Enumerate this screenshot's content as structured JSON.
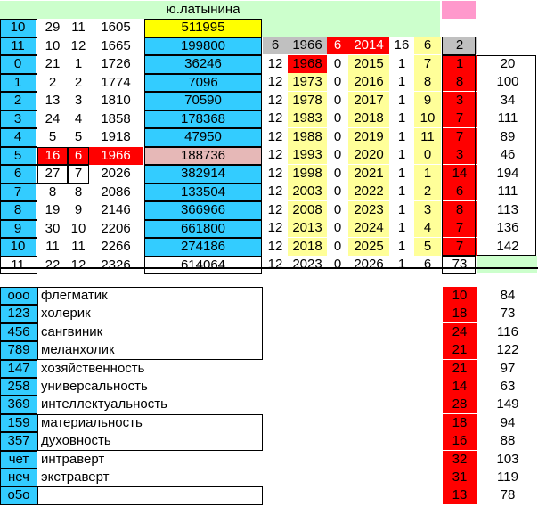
{
  "header": {
    "name": "ю.латынина"
  },
  "rows": [
    {
      "n": "10",
      "a": "29",
      "b": "11",
      "y": "1605",
      "v": "511995"
    },
    {
      "n": "11",
      "a": "10",
      "b": "12",
      "y": "1665",
      "v": "199800"
    },
    {
      "n": "0",
      "a": "21",
      "b": "1",
      "y": "1726",
      "v": "36246"
    },
    {
      "n": "1",
      "a": "2",
      "b": "2",
      "y": "1774",
      "v": "7096"
    },
    {
      "n": "2",
      "a": "13",
      "b": "3",
      "y": "1810",
      "v": "70590"
    },
    {
      "n": "3",
      "a": "24",
      "b": "4",
      "y": "1858",
      "v": "178368"
    },
    {
      "n": "4",
      "a": "5",
      "b": "5",
      "y": "1918",
      "v": "47950"
    },
    {
      "n": "5",
      "a": "16",
      "b": "6",
      "y": "1966",
      "v": "188736"
    },
    {
      "n": "6",
      "a": "27",
      "b": "7",
      "y": "2026",
      "v": "382914"
    },
    {
      "n": "7",
      "a": "8",
      "b": "8",
      "y": "2086",
      "v": "133504"
    },
    {
      "n": "8",
      "a": "19",
      "b": "9",
      "y": "2146",
      "v": "366966"
    },
    {
      "n": "9",
      "a": "30",
      "b": "10",
      "y": "2206",
      "v": "661800"
    },
    {
      "n": "10",
      "a": "11",
      "b": "11",
      "y": "2266",
      "v": "274186"
    },
    {
      "n": "11",
      "a": "22",
      "b": "12",
      "y": "2326",
      "v": "614064"
    }
  ],
  "cycle": [
    {
      "a": "6",
      "b": "1966",
      "c": "6",
      "d": "2014",
      "e": "16",
      "f": "6",
      "g": "2",
      "h": ""
    },
    {
      "a": "12",
      "b": "1968",
      "c": "0",
      "d": "2015",
      "e": "1",
      "f": "7",
      "g": "1",
      "h": "20"
    },
    {
      "a": "12",
      "b": "1973",
      "c": "0",
      "d": "2016",
      "e": "1",
      "f": "8",
      "g": "8",
      "h": "100"
    },
    {
      "a": "12",
      "b": "1978",
      "c": "0",
      "d": "2017",
      "e": "1",
      "f": "9",
      "g": "3",
      "h": "34"
    },
    {
      "a": "12",
      "b": "1983",
      "c": "0",
      "d": "2018",
      "e": "1",
      "f": "10",
      "g": "7",
      "h": "111"
    },
    {
      "a": "12",
      "b": "1988",
      "c": "0",
      "d": "2019",
      "e": "1",
      "f": "11",
      "g": "7",
      "h": "89"
    },
    {
      "a": "12",
      "b": "1993",
      "c": "0",
      "d": "2020",
      "e": "1",
      "f": "0",
      "g": "3",
      "h": "46"
    },
    {
      "a": "12",
      "b": "1998",
      "c": "0",
      "d": "2021",
      "e": "1",
      "f": "1",
      "g": "14",
      "h": "194"
    },
    {
      "a": "12",
      "b": "2003",
      "c": "0",
      "d": "2022",
      "e": "1",
      "f": "2",
      "g": "6",
      "h": "111"
    },
    {
      "a": "12",
      "b": "2008",
      "c": "0",
      "d": "2023",
      "e": "1",
      "f": "3",
      "g": "8",
      "h": "113"
    },
    {
      "a": "12",
      "b": "2013",
      "c": "0",
      "d": "2024",
      "e": "1",
      "f": "4",
      "g": "7",
      "h": "136"
    },
    {
      "a": "12",
      "b": "2018",
      "c": "0",
      "d": "2025",
      "e": "1",
      "f": "5",
      "g": "7",
      "h": "142"
    },
    {
      "a": "12",
      "b": "2023",
      "c": "0",
      "d": "2026",
      "e": "1",
      "f": "6",
      "g": "73",
      "h": ""
    }
  ],
  "traits": [
    {
      "code": "ooo",
      "label": "флегматик",
      "v1": "10",
      "v2": "84"
    },
    {
      "code": "123",
      "label": "холерик",
      "v1": "18",
      "v2": "73"
    },
    {
      "code": "456",
      "label": "сангвиник",
      "v1": "24",
      "v2": "116"
    },
    {
      "code": "789",
      "label": "меланхолик",
      "v1": "21",
      "v2": "122"
    },
    {
      "code": "147",
      "label": "хозяйственность",
      "v1": "21",
      "v2": "97"
    },
    {
      "code": "258",
      "label": "универсальность",
      "v1": "14",
      "v2": "63"
    },
    {
      "code": "369",
      "label": "интеллектуальность",
      "v1": "28",
      "v2": "149"
    },
    {
      "code": "159",
      "label": "материальность",
      "v1": "18",
      "v2": "94"
    },
    {
      "code": "357",
      "label": "духовность",
      "v1": "16",
      "v2": "88"
    },
    {
      "code": "чет",
      "label": "интраверт",
      "v1": "32",
      "v2": "103"
    },
    {
      "code": "неч",
      "label": "экстраверт",
      "v1": "31",
      "v2": "119"
    },
    {
      "code": "о5о",
      "label": "",
      "v1": "13",
      "v2": "78"
    }
  ],
  "colors": {
    "cyan": "#33ccff",
    "yellow": "#ffff00",
    "light_yellow": "#ffff99",
    "light_green": "#ccffcc",
    "red": "#ff0000",
    "pink": "#ff99cc",
    "gray": "#c0c0c0",
    "rose": "#e6b8b7"
  }
}
